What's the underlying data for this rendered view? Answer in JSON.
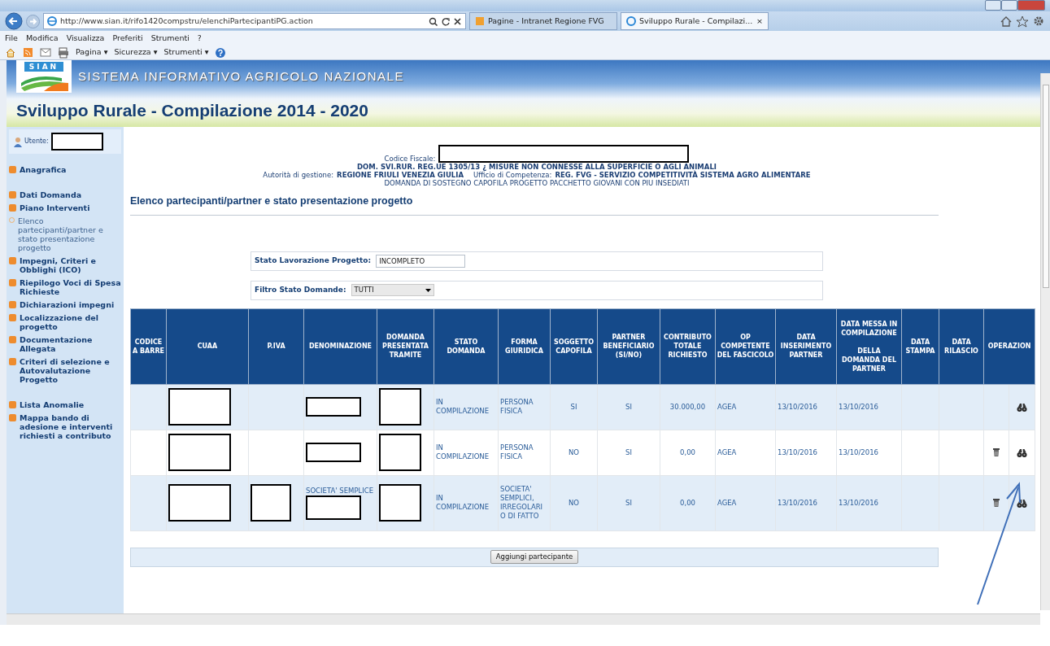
{
  "browser": {
    "url": "http://www.sian.it/rifo1420compstru/elenchiPartecipantiPG.action",
    "tabs": [
      {
        "label": "Pagine - Intranet Regione FVG",
        "selected": false
      },
      {
        "label": "Sviluppo Rurale - Compilazi...",
        "selected": true,
        "close_label": "×"
      }
    ],
    "menu": [
      "File",
      "Modifica",
      "Visualizza",
      "Preferiti",
      "Strumenti",
      "?"
    ],
    "command_bar": [
      "Pagina ▾",
      "Sicurezza ▾",
      "Strumenti ▾"
    ]
  },
  "header": {
    "logo_text": "SIAN",
    "system_name": "SISTEMA INFORMATIVO AGRICOLO NAZIONALE",
    "app_title": "Sviluppo Rurale - Compilazione 2014 - 2020"
  },
  "sidebar": {
    "user_label": "Utente:",
    "groups": [
      [
        {
          "label": "Anagrafica",
          "selected": false
        }
      ],
      [
        {
          "label": "Dati Domanda",
          "selected": false
        },
        {
          "label": "Piano Interventi",
          "selected": false
        },
        {
          "label": "Elenco partecipanti/partner e stato presentazione progetto",
          "selected": true
        },
        {
          "label": "Impegni, Criteri e Obblighi (ICO)",
          "selected": false
        },
        {
          "label": "Riepilogo Voci di Spesa Richieste",
          "selected": false
        },
        {
          "label": "Dichiarazioni impegni",
          "selected": false
        },
        {
          "label": "Localizzazione del progetto",
          "selected": false
        },
        {
          "label": "Documentazione Allegata",
          "selected": false
        },
        {
          "label": "Criteri di selezione e Autovalutazione Progetto",
          "selected": false
        }
      ],
      [
        {
          "label": "Lista Anomalie",
          "selected": false
        },
        {
          "label": "Mappa bando di adesione e interventi richiesti a contributo",
          "selected": false
        }
      ]
    ]
  },
  "info": {
    "codice_fiscale_label": "Codice Fiscale:",
    "domanda": "DOM. SVI.RUR. REG.UE 1305/13 ¿ MISURE NON CONNESSE ALLA SUPERFICIE O AGLI ANIMALI",
    "autorita_label": "Autorità di gestione:",
    "autorita_value": "REGIONE FRIULI VENEZIA GIULIA",
    "ufficio_label": "Ufficio di Competenza:",
    "ufficio_value": "REG. FVG - SERVIZIO COMPETITIVITÀ SISTEMA AGRO ALIMENTARE",
    "descrizione": "DOMANDA DI SOSTEGNO CAPOFILA PROGETTO PACCHETTO GIOVANI CON PIU INSEDIATI"
  },
  "page_title": "Elenco partecipanti/partner e stato presentazione progetto",
  "stato_lavorazione": {
    "label": "Stato Lavorazione Progetto:",
    "value": "INCOMPLETO"
  },
  "filtro": {
    "label": "Filtro Stato Domande:",
    "value": "TUTTI"
  },
  "table": {
    "columns": [
      "CODICE A BARRE",
      "CUAA",
      "P.IVA",
      "DENOMINAZIONE",
      "DOMANDA PRESENTATA TRAMITE",
      "STATO DOMANDA",
      "FORMA GIURIDICA",
      "SOGGETTO CAPOFILA",
      "PARTNER BENEFICIARIO (SI/NO)",
      "CONTRIBUTO TOTALE RICHIESTO",
      "OP COMPETENTE DEL FASCICOLO",
      "DATA INSERIMENTO PARTNER",
      "DATA MESSA IN COMPILAZIONE\n\nDELLA DOMANDA DEL PARTNER",
      "DATA STAMPA",
      "DATA RILASCIO",
      "OPERAZION"
    ],
    "rows": [
      {
        "cells": [
          {},
          {
            "redacted": true
          },
          {},
          {
            "redacted": true
          },
          {
            "redacted": true
          },
          {
            "text": "IN COMPILAZIONE"
          },
          {
            "text": "PERSONA FISICA"
          },
          {
            "text": "SI"
          },
          {
            "text": "SI"
          },
          {
            "text": "30.000,00"
          },
          {
            "text": "AGEA"
          },
          {
            "text": "13/10/2016"
          },
          {
            "text": "13/10/2016"
          },
          {},
          {}
        ],
        "can_delete": false,
        "can_view": true
      },
      {
        "cells": [
          {},
          {
            "redacted": true
          },
          {},
          {
            "redacted": true
          },
          {
            "redacted": true
          },
          {
            "text": "IN COMPILAZIONE"
          },
          {
            "text": "PERSONA FISICA"
          },
          {
            "text": "NO"
          },
          {
            "text": "SI"
          },
          {
            "text": "0,00"
          },
          {
            "text": "AGEA"
          },
          {
            "text": "13/10/2016"
          },
          {
            "text": "13/10/2016"
          },
          {},
          {}
        ],
        "can_delete": true,
        "can_view": true
      },
      {
        "cells": [
          {},
          {
            "redacted": true
          },
          {
            "redacted": true
          },
          {
            "text": "SOCIETA' SEMPLICE",
            "redacted": true
          },
          {
            "redacted": true
          },
          {
            "text": "IN COMPILAZIONE"
          },
          {
            "text": "SOCIETA' SEMPLICI, IRREGOLARI O DI FATTO"
          },
          {
            "text": "NO"
          },
          {
            "text": "SI"
          },
          {
            "text": "0,00"
          },
          {
            "text": "AGEA"
          },
          {
            "text": "13/10/2016"
          },
          {
            "text": "13/10/2016"
          },
          {},
          {}
        ],
        "can_delete": true,
        "can_view": true
      }
    ]
  },
  "add_button": "Aggiungi partecipante"
}
